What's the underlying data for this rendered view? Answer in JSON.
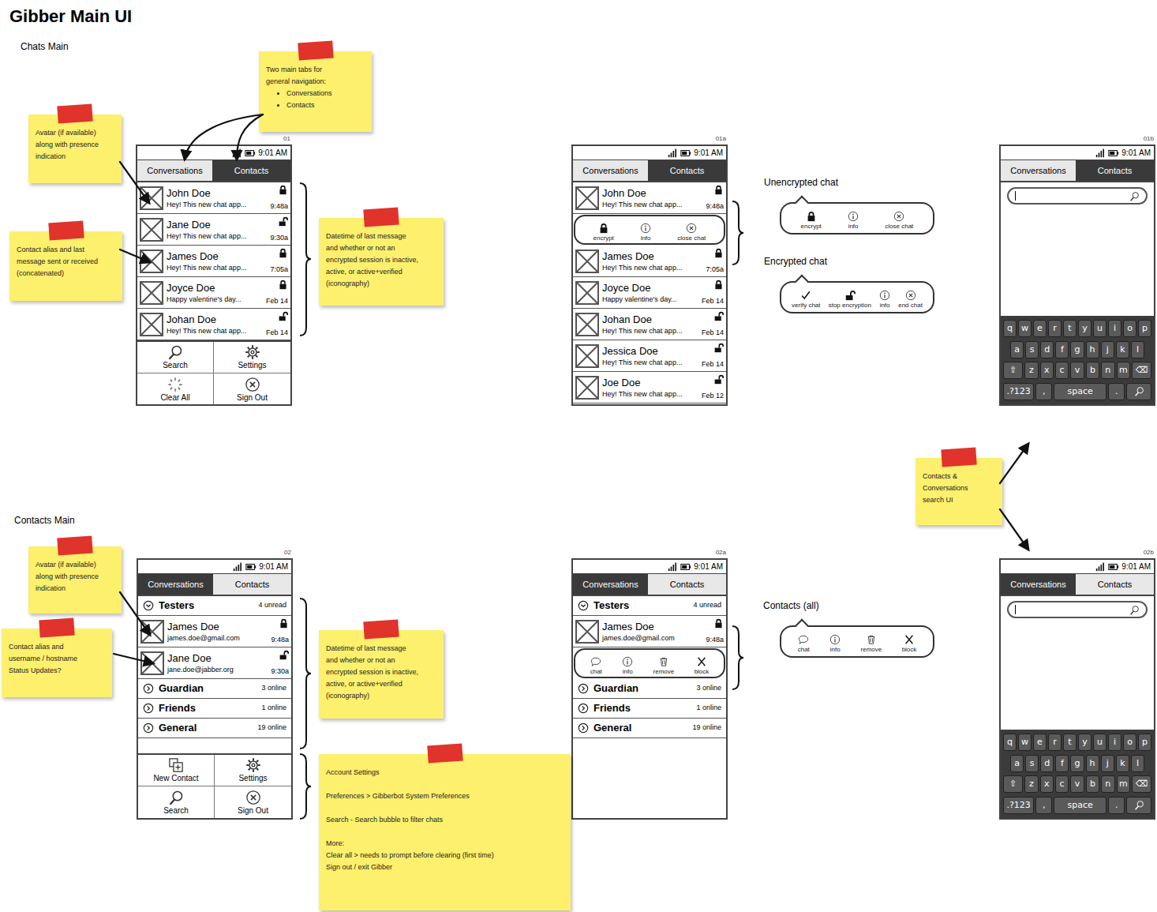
{
  "title": "Gibber Main UI",
  "sections": [
    "Chats Main",
    "Contacts Main"
  ],
  "screens": [
    {
      "code": "01",
      "time": "9:01 AM",
      "tabs": [
        {
          "label": "Conversations",
          "selected": true
        },
        {
          "label": "Contacts",
          "selected": false
        }
      ],
      "rows": [
        {
          "kind": "chat",
          "name": "John Doe",
          "text": "Hey! This new chat app...",
          "time": "9:48a",
          "encrypted": true
        },
        {
          "kind": "chat",
          "name": "Jane Doe",
          "text": "Hey! This new chat app...",
          "time": "9:30a",
          "encrypted": false
        },
        {
          "kind": "chat",
          "name": "James Doe",
          "text": "Hey! This new chat app...",
          "time": "7:05a",
          "encrypted": true
        },
        {
          "kind": "chat",
          "name": "Joyce Doe",
          "text": "Happy valentine's day...",
          "time": "Feb 14",
          "encrypted": true
        },
        {
          "kind": "chat",
          "name": "Johan Doe",
          "text": "Hey! This new chat app...",
          "time": "Feb 14",
          "encrypted": false
        }
      ],
      "menu": [
        "Search",
        "Settings",
        "Clear All",
        "Sign Out"
      ]
    },
    {
      "code": "01a",
      "time": "9:01 AM",
      "tabs": [
        {
          "label": "Conversations",
          "selected": true
        },
        {
          "label": "Contacts",
          "selected": false
        }
      ],
      "rows": [
        {
          "kind": "chat",
          "name": "John Doe",
          "text": "Hey! This new chat app...",
          "time": "9:48a",
          "encrypted": true
        },
        {
          "kind": "actions",
          "items": [
            "encrypt",
            "info",
            "close chat"
          ]
        },
        {
          "kind": "chat",
          "name": "James Doe",
          "text": "Hey! This new chat app...",
          "time": "7:05a",
          "encrypted": true
        },
        {
          "kind": "chat",
          "name": "Joyce Doe",
          "text": "Happy valentine's day...",
          "time": "Feb 14",
          "encrypted": true
        },
        {
          "kind": "chat",
          "name": "Johan Doe",
          "text": "Hey! This new chat app...",
          "time": "Feb 14",
          "encrypted": false
        },
        {
          "kind": "chat",
          "name": "Jessica Doe",
          "text": "Hey! This new chat app...",
          "time": "Feb 14",
          "encrypted": false
        },
        {
          "kind": "chat",
          "name": "Joe Doe",
          "text": "Hey! This new chat app...",
          "time": "Feb 12",
          "encrypted": false
        }
      ],
      "menu": []
    },
    {
      "code": "01b",
      "time": "9:01 AM",
      "tabs": [
        {
          "label": "Conversations",
          "selected": true
        },
        {
          "label": "Contacts",
          "selected": false
        }
      ],
      "rows": [],
      "menu": [],
      "search": {
        "keyboard": [
          [
            "q",
            "w",
            "e",
            "r",
            "t",
            "y",
            "u",
            "i",
            "o",
            "p"
          ],
          [
            "a",
            "s",
            "d",
            "f",
            "g",
            "h",
            "j",
            "k",
            "l"
          ],
          [
            "⇧",
            "z",
            "x",
            "c",
            "v",
            "b",
            "n",
            "m",
            "⌫"
          ],
          [
            ".?123",
            ",",
            "space",
            "."
          ]
        ]
      }
    },
    {
      "code": "02",
      "time": "9:01 AM",
      "tabs": [
        {
          "label": "Conversations",
          "selected": false
        },
        {
          "label": "Contacts",
          "selected": true
        }
      ],
      "rows": [
        {
          "kind": "group",
          "name": "Testers",
          "count": "4 unread",
          "expanded": true
        },
        {
          "kind": "contact",
          "name": "James Doe",
          "text": "james.doe@gmail.com",
          "time": "9:48a",
          "encrypted": true
        },
        {
          "kind": "contact",
          "name": "Jane Doe",
          "text": "jane.doe@jabber.org",
          "time": "9:30a",
          "encrypted": false
        },
        {
          "kind": "group",
          "name": "Guardian",
          "count": "3 online",
          "expanded": false
        },
        {
          "kind": "group",
          "name": "Friends",
          "count": "1 online",
          "expanded": false
        },
        {
          "kind": "group",
          "name": "General",
          "count": "19 online",
          "expanded": false
        }
      ],
      "menu": [
        "New Contact",
        "Settings",
        "Search",
        "Sign Out"
      ]
    },
    {
      "code": "02a",
      "time": "9:01 AM",
      "tabs": [
        {
          "label": "Conversations",
          "selected": false
        },
        {
          "label": "Contacts",
          "selected": true
        }
      ],
      "rows": [
        {
          "kind": "group",
          "name": "Testers",
          "count": "4 unread",
          "expanded": true
        },
        {
          "kind": "contact",
          "name": "James Doe",
          "text": "james.doe@gmail.com",
          "time": "9:48a",
          "encrypted": true
        },
        {
          "kind": "actions",
          "items": [
            "chat",
            "info",
            "remove",
            "block"
          ]
        },
        {
          "kind": "group",
          "name": "Guardian",
          "count": "3 online",
          "expanded": false
        },
        {
          "kind": "group",
          "name": "Friends",
          "count": "1 online",
          "expanded": false
        },
        {
          "kind": "group",
          "name": "General",
          "count": "19 online",
          "expanded": false
        }
      ],
      "menu": []
    },
    {
      "code": "02b",
      "time": "9:01 AM",
      "tabs": [
        {
          "label": "Conversations",
          "selected": false
        },
        {
          "label": "Contacts",
          "selected": true
        }
      ],
      "rows": [],
      "menu": [],
      "search": {
        "keyboard": [
          [
            "q",
            "w",
            "e",
            "r",
            "t",
            "y",
            "u",
            "i",
            "o",
            "p"
          ],
          [
            "a",
            "s",
            "d",
            "f",
            "g",
            "h",
            "j",
            "k",
            "l"
          ],
          [
            "⇧",
            "z",
            "x",
            "c",
            "v",
            "b",
            "n",
            "m",
            "⌫"
          ],
          [
            ".?123",
            ",",
            "space",
            "."
          ]
        ]
      }
    }
  ],
  "callouts": [
    {
      "label": "Unencrypted chat",
      "items": [
        "encrypt",
        "info",
        "close chat"
      ]
    },
    {
      "label": "Encrypted chat",
      "items": [
        "verify chat",
        "stop encryption",
        "info",
        "end chat"
      ]
    },
    {
      "label": "Contacts (all)",
      "items": [
        "chat",
        "info",
        "remove",
        "block"
      ]
    }
  ],
  "notes": [
    {
      "paragraphs": [
        [
          "Two main tabs for",
          "general navigation:"
        ]
      ],
      "bullets": [
        "Conversations",
        "Contacts"
      ]
    },
    {
      "paragraphs": [
        [
          "Avatar (if available)",
          "along with presence",
          "indication"
        ]
      ],
      "bullets": []
    },
    {
      "paragraphs": [
        [
          "Contact alias and last",
          "message sent or received",
          "(concatenated)"
        ]
      ],
      "bullets": []
    },
    {
      "paragraphs": [
        [
          "Datetime of last message",
          "and whether or not an",
          "encrypted session is inactive,",
          "active, or active+verified",
          "(iconography)"
        ]
      ],
      "bullets": []
    },
    {
      "paragraphs": [
        [
          "Avatar (if available)",
          "along with presence",
          "indication"
        ]
      ],
      "bullets": []
    },
    {
      "paragraphs": [
        [
          "Contact alias and",
          "username / hostname",
          "Status Updates?"
        ]
      ],
      "bullets": []
    },
    {
      "paragraphs": [
        [
          "Datetime of last message",
          "and whether or not an",
          "encrypted session is inactive,",
          "active, or active+verified",
          "(iconography)"
        ]
      ],
      "bullets": []
    },
    {
      "paragraphs": [
        [
          "Account Settings"
        ],
        [
          "Preferences > Gibberbot System Preferences"
        ],
        [
          "Search - Search bubble to filter chats"
        ],
        [
          "More:",
          "Clear all > needs to prompt before clearing (first time)",
          "Sign out / exit Gibber"
        ]
      ],
      "bullets": []
    },
    {
      "paragraphs": [
        [
          "Contacts &",
          "Conversations",
          "search UI"
        ]
      ],
      "bullets": []
    }
  ]
}
